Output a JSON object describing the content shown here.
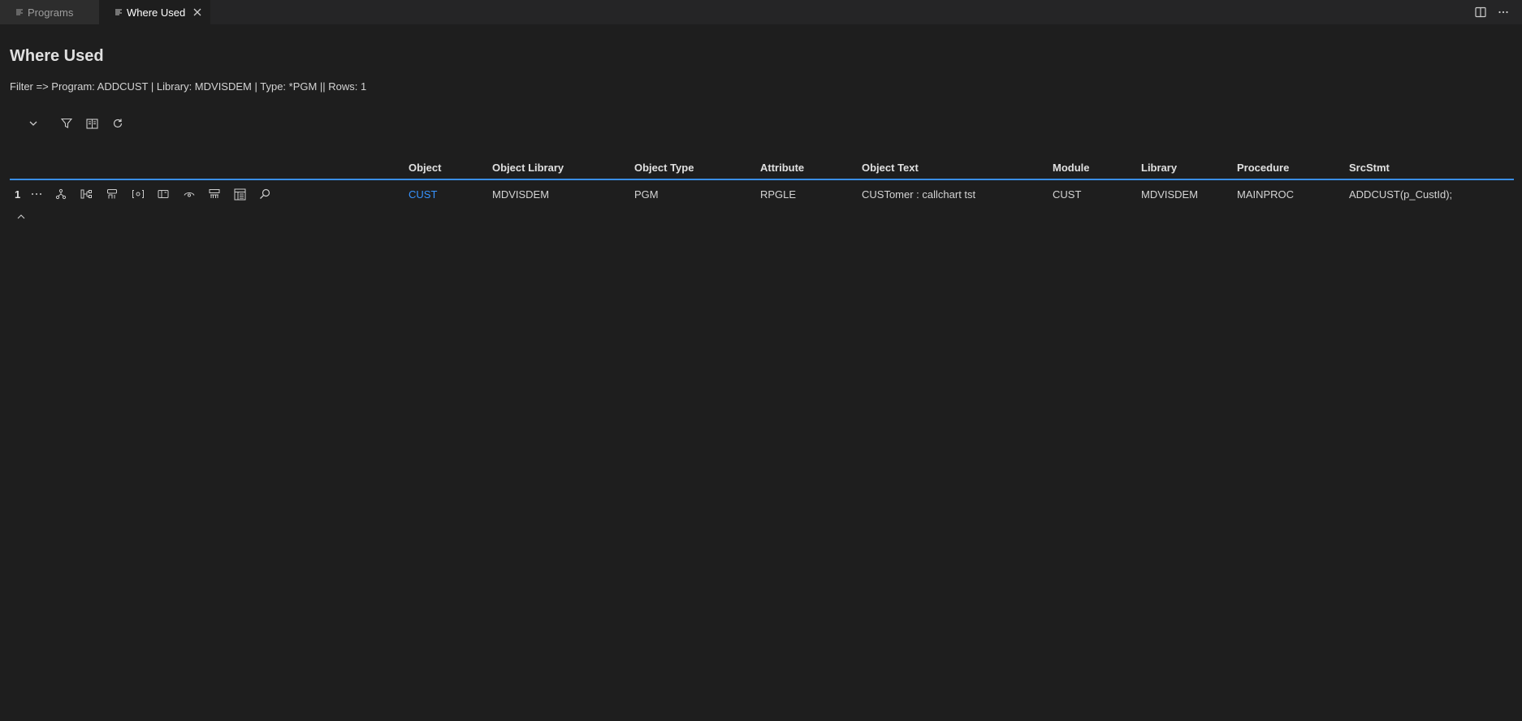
{
  "tabs": [
    {
      "label": "Programs",
      "icon": "list-lines-icon",
      "active": false
    },
    {
      "label": "Where Used",
      "icon": "list-lines-icon",
      "active": true
    }
  ],
  "page": {
    "title": "Where Used",
    "filter": "Filter => Program: ADDCUST | Library: MDVISDEM | Type: *PGM || Rows: 1"
  },
  "toolbar": {
    "icons": [
      "chevron-down-icon",
      "filter-icon",
      "columns-icon",
      "refresh-icon"
    ]
  },
  "table": {
    "columns": [
      "Object",
      "Object Library",
      "Object Type",
      "Attribute",
      "Object Text",
      "Module",
      "Library",
      "Procedure",
      "SrcStmt"
    ],
    "rows": [
      {
        "num": "1",
        "cells": [
          "CUST",
          "MDVISDEM",
          "PGM",
          "RPGLE",
          "CUSTomer : callchart tst",
          "CUST",
          "MDVISDEM",
          "MAINPROC",
          "ADDCUST(p_CustId);"
        ]
      }
    ]
  },
  "colors": {
    "background": "#1e1e1e",
    "accent": "#3a8ee6",
    "link": "#3794ff"
  }
}
